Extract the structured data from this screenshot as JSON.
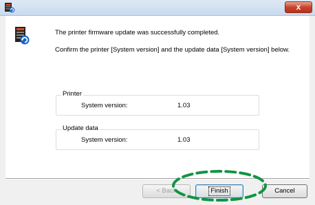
{
  "titlebar": {
    "icon": "printer-firmware-icon",
    "close_label": "x"
  },
  "message": {
    "icon": "firmware-update-icon",
    "line1": "The printer firmware update was successfully completed.",
    "line2": "Confirm the printer [System version] and the update data [System version] below."
  },
  "printer_group": {
    "label": "Printer",
    "field_label": "System version:",
    "field_value": "1.03"
  },
  "update_group": {
    "label": "Update data",
    "field_label": "System version:",
    "field_value": "1.03"
  },
  "buttons": {
    "back": "< Back",
    "finish": "Finish",
    "cancel": "Cancel"
  },
  "colors": {
    "highlight": "#119444",
    "close_button": "#c8442c"
  }
}
